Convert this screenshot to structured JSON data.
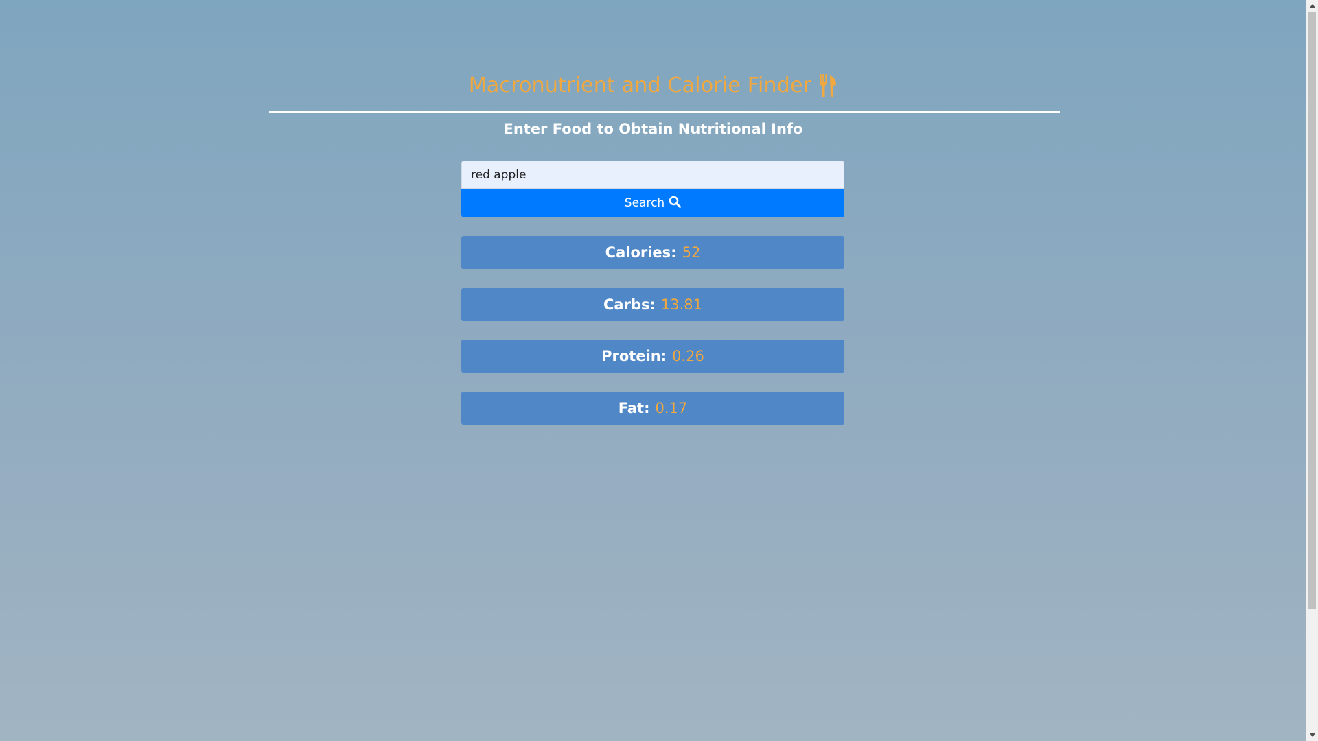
{
  "header": {
    "title": "Macronutrient and Calorie Finder",
    "title_icon": "utensils-icon",
    "subtitle": "Enter Food to Obtain Nutritional Info"
  },
  "search": {
    "value": "red apple",
    "button_label": "Search",
    "button_icon": "search-icon"
  },
  "results": [
    {
      "label": "Calories:",
      "value": "52"
    },
    {
      "label": "Carbs:",
      "value": "13.81"
    },
    {
      "label": "Protein:",
      "value": "0.26"
    },
    {
      "label": "Fat:",
      "value": "0.17"
    }
  ],
  "colors": {
    "accent_orange": "#f1a83e",
    "button_blue": "#007bff",
    "card_blue": "#4f87c7"
  }
}
